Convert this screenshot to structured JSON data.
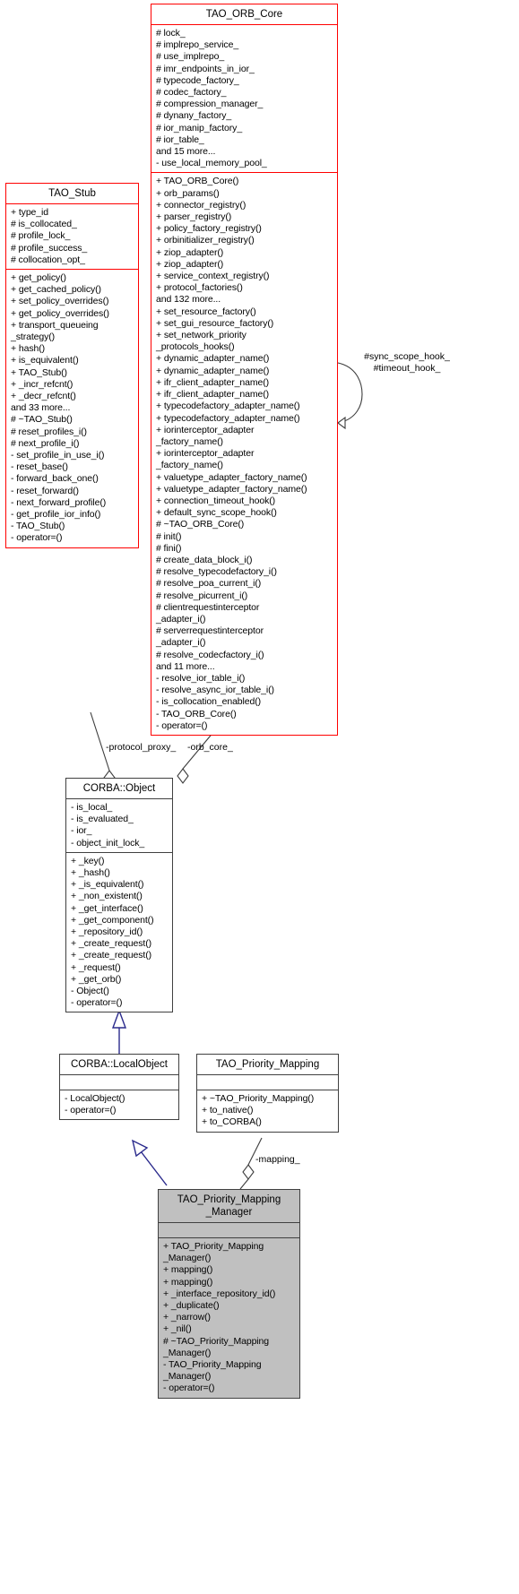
{
  "diagram": {
    "kind": "uml-class-diagram",
    "colors": {
      "red_border": "#ff0000",
      "black_border": "#000000",
      "inherit_arrow": "#2a2a8c",
      "highlight_fill": "#c0c0c0"
    }
  },
  "classes": {
    "orb_core": {
      "name": "TAO_ORB_Core",
      "attributes": [
        "# lock_",
        "# implrepo_service_",
        "# use_implrepo_",
        "# imr_endpoints_in_ior_",
        "# typecode_factory_",
        "# codec_factory_",
        "# compression_manager_",
        "# dynany_factory_",
        "# ior_manip_factory_",
        "# ior_table_",
        "and 15 more...",
        "- use_local_memory_pool_"
      ],
      "operations": [
        "+ TAO_ORB_Core()",
        "+ orb_params()",
        "+ connector_registry()",
        "+ parser_registry()",
        "+ policy_factory_registry()",
        "+ orbinitializer_registry()",
        "+ ziop_adapter()",
        "+ ziop_adapter()",
        "+ service_context_registry()",
        "+ protocol_factories()",
        "and 132 more...",
        "+ set_resource_factory()",
        "+ set_gui_resource_factory()",
        "+ set_network_priority\n_protocols_hooks()",
        "+ dynamic_adapter_name()",
        "+ dynamic_adapter_name()",
        "+ ifr_client_adapter_name()",
        "+ ifr_client_adapter_name()",
        "+ typecodefactory_adapter_name()",
        "+ typecodefactory_adapter_name()",
        "+ iorinterceptor_adapter\n_factory_name()",
        "+ iorinterceptor_adapter\n_factory_name()",
        "+ valuetype_adapter_factory_name()",
        "+ valuetype_adapter_factory_name()",
        "+ connection_timeout_hook()",
        "+ default_sync_scope_hook()",
        "# ~TAO_ORB_Core()",
        "# init()",
        "# fini()",
        "# create_data_block_i()",
        "# resolve_typecodefactory_i()",
        "# resolve_poa_current_i()",
        "# resolve_picurrent_i()",
        "# clientrequestinterceptor\n_adapter_i()",
        "# serverrequestinterceptor\n_adapter_i()",
        "# resolve_codecfactory_i()",
        "and 11 more...",
        "- resolve_ior_table_i()",
        "- resolve_async_ior_table_i()",
        "- is_collocation_enabled()",
        "- TAO_ORB_Core()",
        "- operator=()"
      ]
    },
    "stub": {
      "name": "TAO_Stub",
      "attributes": [
        "+ type_id",
        "# is_collocated_",
        "# profile_lock_",
        "# profile_success_",
        "# collocation_opt_"
      ],
      "operations": [
        "+ get_policy()",
        "+ get_cached_policy()",
        "+ set_policy_overrides()",
        "+ get_policy_overrides()",
        "+ transport_queueing\n_strategy()",
        "+ hash()",
        "+ is_equivalent()",
        "+ TAO_Stub()",
        "+ _incr_refcnt()",
        "+ _decr_refcnt()",
        "and 33 more...",
        "# ~TAO_Stub()",
        "# reset_profiles_i()",
        "# next_profile_i()",
        "- set_profile_in_use_i()",
        "- reset_base()",
        "- forward_back_one()",
        "- reset_forward()",
        "- next_forward_profile()",
        "- get_profile_ior_info()",
        "- TAO_Stub()",
        "- operator=()"
      ]
    },
    "corba_object": {
      "name": "CORBA::Object",
      "attributes": [
        "- is_local_",
        "- is_evaluated_",
        "- ior_",
        "- object_init_lock_"
      ],
      "operations": [
        "+ _key()",
        "+ _hash()",
        "+ _is_equivalent()",
        "+ _non_existent()",
        "+ _get_interface()",
        "+ _get_component()",
        "+ _repository_id()",
        "+ _create_request()",
        "+ _create_request()",
        "+ _request()",
        "+ _get_orb()",
        "- Object()",
        "- operator=()"
      ]
    },
    "corba_localobject": {
      "name": "CORBA::LocalObject",
      "attributes": [],
      "operations": [
        "- LocalObject()",
        "- operator=()"
      ]
    },
    "priority_mapping": {
      "name": "TAO_Priority_Mapping",
      "attributes": [],
      "operations": [
        "+ ~TAO_Priority_Mapping()",
        "+ to_native()",
        "+ to_CORBA()"
      ]
    },
    "priority_mapping_manager": {
      "name": "TAO_Priority_Mapping\n_Manager",
      "attributes": [],
      "operations": [
        "+ TAO_Priority_Mapping\n_Manager()",
        "+ mapping()",
        "+ mapping()",
        "+ _interface_repository_id()",
        "+ _duplicate()",
        "+ _narrow()",
        "+ _nil()",
        "# ~TAO_Priority_Mapping\n_Manager()",
        "- TAO_Priority_Mapping\n_Manager()",
        "- operator=()"
      ]
    }
  },
  "edge_labels": {
    "sync_scope_timeout": "#sync_scope_hook_\n#timeout_hook_",
    "protocol_proxy": "-protocol_proxy_",
    "orb_core": "-orb_core_",
    "mapping": "-mapping_"
  }
}
